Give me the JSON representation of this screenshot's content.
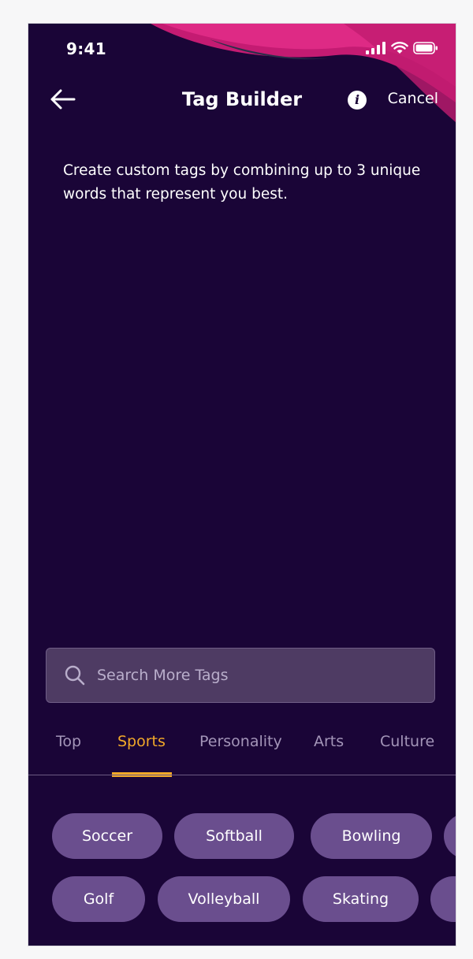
{
  "status_bar": {
    "time": "9:41",
    "icons": [
      "signal-icon",
      "wifi-icon",
      "battery-icon"
    ]
  },
  "nav": {
    "back_icon": "arrow-left-icon",
    "title": "Tag Builder",
    "info_glyph": "i",
    "cancel_label": "Cancel"
  },
  "description": "Create custom tags by combining up to 3 unique words that represent you best.",
  "search": {
    "icon": "search-icon",
    "placeholder": "Search More Tags"
  },
  "tabs": {
    "items": [
      {
        "label": "Top"
      },
      {
        "label": "Sports"
      },
      {
        "label": "Personality"
      },
      {
        "label": "Arts"
      },
      {
        "label": "Culture"
      }
    ],
    "active": "Sports"
  },
  "tags": {
    "row1": [
      {
        "label": "Soccer"
      },
      {
        "label": "Softball"
      },
      {
        "label": "Bowling"
      }
    ],
    "row2": [
      {
        "label": "Golf"
      },
      {
        "label": "Volleyball"
      },
      {
        "label": "Skating"
      }
    ]
  },
  "colors": {
    "background": "#1a0537",
    "accent": "#f2a929",
    "chip": "#6a4e8e",
    "wave": "#d42579"
  }
}
